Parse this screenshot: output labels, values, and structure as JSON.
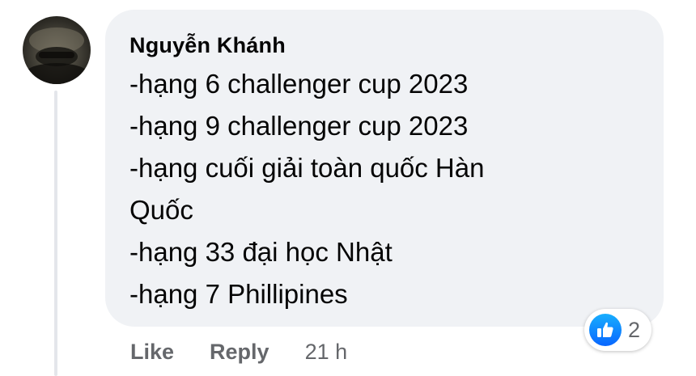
{
  "comment": {
    "author": "Nguyễn Khánh",
    "lines": [
      "-hạng 6 challenger cup 2023",
      "-hạng 9 challenger cup 2023",
      "-hạng cuối giải toàn quốc Hàn",
      "Quốc",
      "-hạng 33 đại học Nhật",
      "-hạng 7 Phillipines"
    ]
  },
  "actions": {
    "like_label": "Like",
    "reply_label": "Reply",
    "timestamp": "21 h"
  },
  "reactions": {
    "icon": "thumbs-up-icon",
    "count": "2",
    "badge_color": "#0866ff"
  },
  "colors": {
    "bubble_bg": "#f0f2f5",
    "text": "#050505",
    "muted": "#65676b"
  }
}
